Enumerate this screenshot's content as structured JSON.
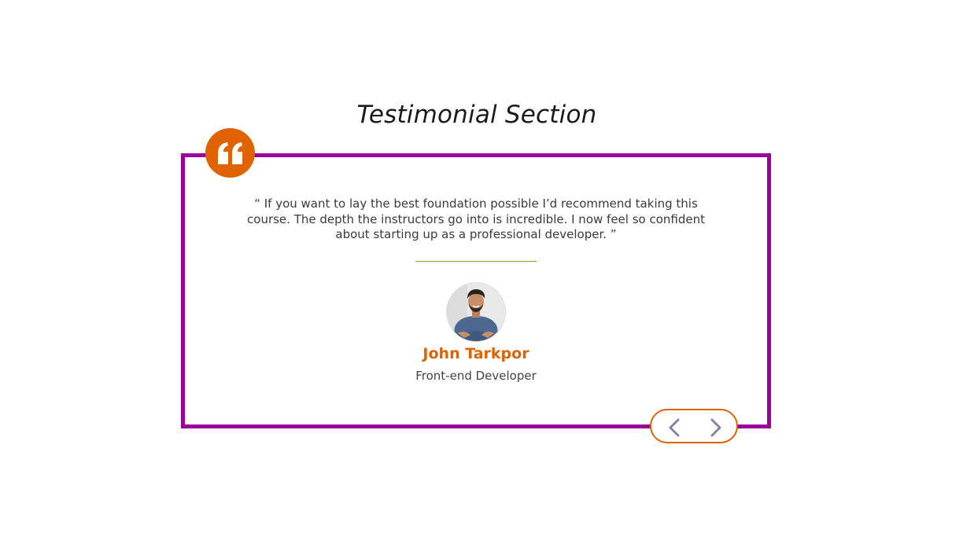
{
  "section": {
    "title": "Testimonial Section"
  },
  "testimonial": {
    "quote": "“ If you want to lay the best foundation possible I’d recommend taking this course. The depth the instructors go into is incredible. I now feel so confident about starting up as a professional developer. ”",
    "name": "John Tarkpor",
    "role": "Front-end Developer",
    "avatar_alt": "John Tarkpor"
  },
  "navigation": {
    "prev_icon": "chevron-left-icon",
    "next_icon": "chevron-right-icon"
  },
  "colors": {
    "card_border": "#990099",
    "accent": "#e06200",
    "divider": "#b5902a",
    "chevron": "#8a80b0"
  }
}
